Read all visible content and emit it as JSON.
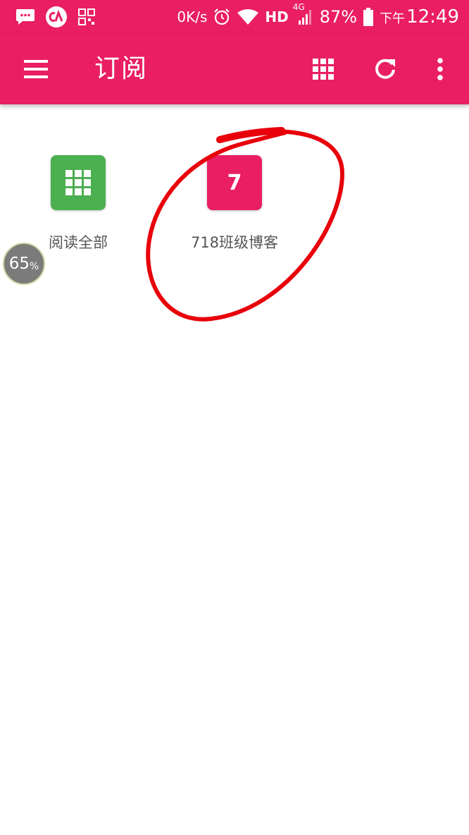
{
  "status_bar": {
    "net_speed": "0K/s",
    "network_label": "HD",
    "network_type": "4G",
    "battery": "87%",
    "ampm": "下午",
    "time": "12:49",
    "left_icons": [
      "message-icon",
      "ca-app-icon",
      "qr-icon"
    ],
    "right_icons": [
      "alarm-icon",
      "wifi-icon",
      "signal-icon",
      "battery-icon"
    ]
  },
  "app_bar": {
    "title": "订阅",
    "icons": [
      "menu-icon",
      "grid-view-icon",
      "refresh-icon",
      "more-vert-icon"
    ]
  },
  "feeds": [
    {
      "label": "阅读全部",
      "icon": "grid-icon",
      "color": "#4CAF50"
    },
    {
      "label": "718班级博客",
      "initial": "7",
      "color": "#E91E63"
    }
  ],
  "float_badge": {
    "value": "65",
    "unit": "%"
  },
  "colors": {
    "primary": "#E91E63",
    "accent_green": "#4CAF50",
    "annotation_red": "#E8000B"
  }
}
